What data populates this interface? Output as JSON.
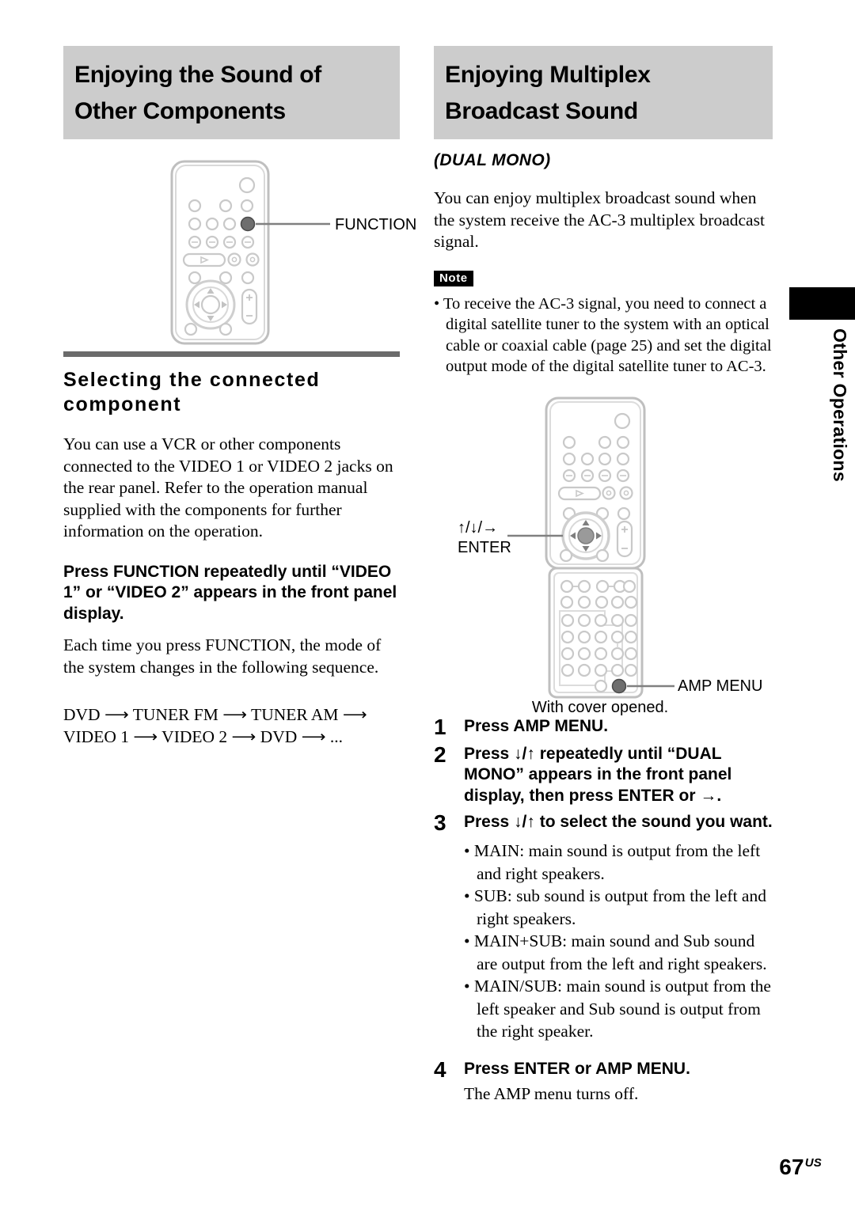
{
  "page": {
    "number": "67",
    "region_suffix": "US",
    "side_tab_label": "Other Operations"
  },
  "left_column": {
    "section_title_line1": "Enjoying the Sound of",
    "section_title_line2": "Other Components",
    "figure": {
      "callout_label": "FUNCTION",
      "remote_name": "remote-control-function"
    },
    "subsection_title_line1": "Selecting the connected",
    "subsection_title_line2": "component",
    "intro_paragraph": "You can use a VCR or other components connected to the VIDEO 1 or VIDEO 2 jacks on the rear panel. Refer to the operation manual supplied with the components for further information on the operation.",
    "instruction_bold": "Press FUNCTION repeatedly until “VIDEO 1” or “VIDEO 2” appears in the front panel display.",
    "instruction_body": "Each time you press FUNCTION, the mode of the system changes in the following sequence.",
    "sequence_line1": "DVD ⟶ TUNER FM ⟶ TUNER AM ⟶",
    "sequence_line2": "VIDEO 1 ⟶ VIDEO 2 ⟶ DVD ⟶ ..."
  },
  "right_column": {
    "section_title_line1": "Enjoying Multiplex",
    "section_title_line2": "Broadcast Sound",
    "subtitle": "(DUAL MONO)",
    "intro_paragraph": "You can enjoy multiplex broadcast sound when the system receive the AC-3 multiplex broadcast signal.",
    "note_badge": "Note",
    "note_items": [
      "• To receive the AC-3 signal, you need to connect a digital satellite tuner to the system with an optical cable or coaxial cable (page 25) and set the digital output mode of the digital satellite tuner to AC-3."
    ],
    "figure": {
      "callout_label_line1": "↑/↓/→",
      "callout_label_line2": "ENTER",
      "callout_label_amp": "AMP MENU",
      "caption": "With cover opened.",
      "remote_name": "remote-control-cover-opened"
    },
    "steps": [
      {
        "num": "1",
        "text": "Press AMP MENU.",
        "sub": ""
      },
      {
        "num": "2",
        "text": "Press ↓/↑ repeatedly until “DUAL MONO” appears in the front panel display, then press ENTER or →.",
        "sub": ""
      },
      {
        "num": "3",
        "text": "Press ↓/↑ to select the sound you want.",
        "sub": ""
      }
    ],
    "sound_options": [
      "• MAIN: main sound is output from the left and right speakers.",
      "• SUB: sub sound is output from the left and right speakers.",
      "• MAIN+SUB: main sound and Sub sound are output from the left and right speakers.",
      "• MAIN/SUB: main sound is output from the left speaker and Sub sound is output from the right speaker."
    ],
    "step4": {
      "num": "4",
      "text": "Press ENTER or AMP MENU.",
      "sub": "The AMP menu turns off."
    }
  }
}
